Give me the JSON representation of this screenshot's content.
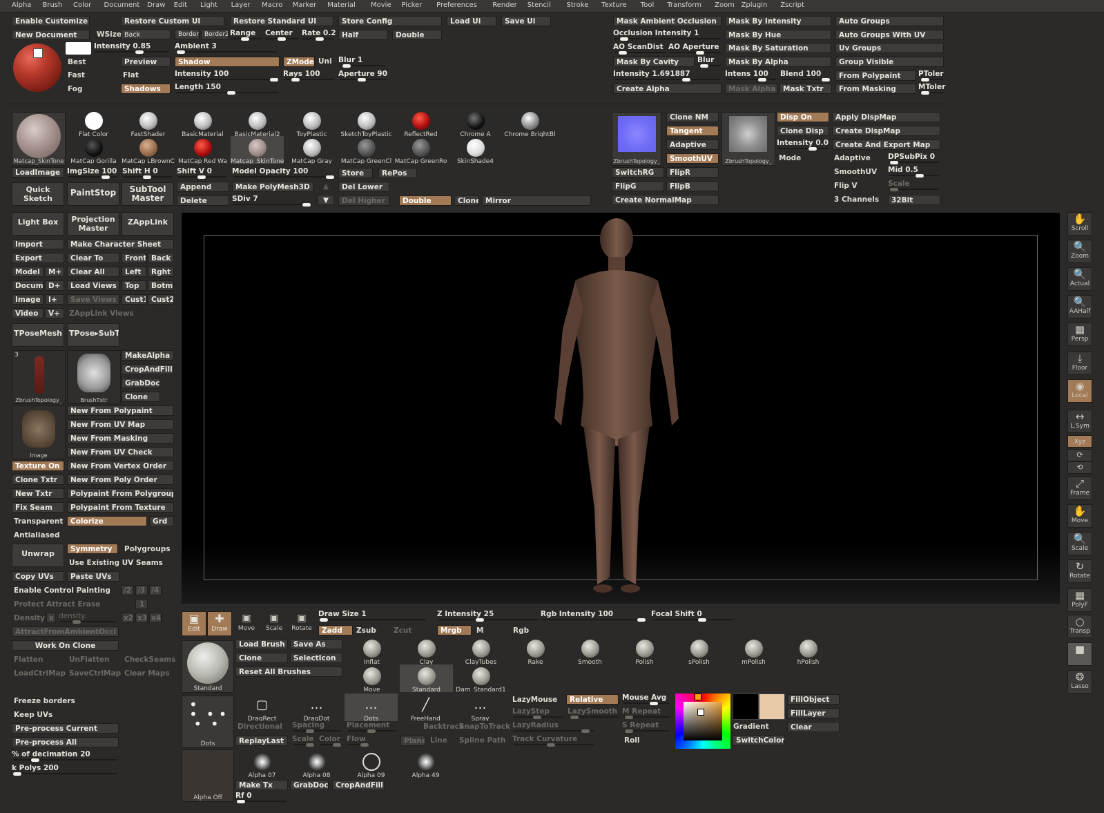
{
  "menu": [
    "Alpha",
    "Brush",
    "Color",
    "Document",
    "Draw",
    "Edit",
    "Light",
    "Layer",
    "Macro",
    "Marker",
    "Material",
    "Movie",
    "Picker",
    "Preferences",
    "Render",
    "Stencil",
    "Stroke",
    "Texture",
    "Tool",
    "Transform",
    "Zoom",
    "Zplugin",
    "Zscript"
  ],
  "colors": {
    "accent": "#a27a56",
    "panel": "#2b2a28",
    "button": "#3d3c3a",
    "canvas": "#000000",
    "secondary_color": "#e8c9a8"
  },
  "top": {
    "enable_customize": "Enable Customize",
    "restore_custom_ui": "Restore Custom UI",
    "restore_standard_ui": "Restore Standard UI",
    "store_config": "Store Config",
    "load_ui": "Load Ui",
    "save_ui": "Save Ui",
    "new_document": "New Document",
    "wsize": "WSize",
    "back": "Back",
    "border": "Border",
    "border2": "Border2",
    "range": "Range",
    "center": "Center",
    "rate": "Rate 0.2",
    "half": "Half",
    "double": "Double",
    "intensity": "Intensity 0.85",
    "ambient": "Ambient 3",
    "best": "Best",
    "preview": "Preview",
    "shadow": "Shadow",
    "zmode": "ZMode",
    "uni": "Uni",
    "blur": "Blur 1",
    "fast": "Fast",
    "flat": "Flat",
    "intensity100": "Intensity 100",
    "rays": "Rays 100",
    "aperture": "Aperture 90",
    "fog": "Fog",
    "shadows": "Shadows",
    "length": "Length 150"
  },
  "mask": {
    "col1": [
      "Mask Ambient Occlusion",
      "Occlusion Intensity 1",
      "AO ScanDist",
      "AO Aperture",
      "Mask By Cavity",
      "Blur",
      "Intensity 1.691887",
      "Create Alpha"
    ],
    "col2": [
      "Mask By Intensity",
      "Mask By Hue",
      "Mask By Saturation",
      "Mask By Alpha",
      "Intens 100",
      "Blend 100",
      "Mask Alpha",
      "Mask Txtr"
    ],
    "col3": [
      "Auto Groups",
      "Auto Groups With UV",
      "Uv Groups",
      "Group Visible",
      "From Polypaint",
      "PToler",
      "From Masking",
      "MToler"
    ]
  },
  "materials": {
    "current": "Matcap_SkinTone",
    "load_image": "LoadImage",
    "row1": [
      "Flat Color",
      "FastShader",
      "BasicMaterial",
      "BasicMaterial2",
      "ToyPlastic",
      "SketchToyPlastic",
      "ReflectRed",
      "Chrome A",
      "Chrome BrightBl"
    ],
    "row2": [
      "MatCap Gorilla",
      "MatCap LBrownC",
      "MatCap Red Wa",
      "Matcap_SkinTone",
      "MatCap Gray",
      "MatCap GreenCl",
      "MatCap GreenRo",
      "SkinShade4"
    ],
    "imgsize": "ImgSize 100",
    "shift_h": "Shift H 0",
    "shift_v": "Shift V 0",
    "model_opacity": "Model Opacity 100",
    "store": "Store",
    "repos": "RePos"
  },
  "subtool": {
    "quick_sketch": "Quick Sketch",
    "paintstop": "PaintStop",
    "subtool_master": "SubTool Master",
    "append": "Append",
    "make_polymesh": "Make PolyMesh3D",
    "del_lower": "Del Lower",
    "delete": "Delete",
    "sdiv": "SDiv 7",
    "del_higher": "Del Higher",
    "double": "Double",
    "clone": "Clone",
    "mirror": "Mirror"
  },
  "normal": {
    "clone_nm": "Clone NM",
    "tangent": "Tangent",
    "adaptive": "Adaptive",
    "smoothuv": "SmoothUV",
    "disp_on": "Disp On",
    "clone_disp": "Clone Disp",
    "intensity": "Intensity 0.0",
    "mode": "Mode",
    "apply_dispmap": "Apply DispMap",
    "create_dispmap": "Create DispMap",
    "create_export": "Create And Export Map",
    "adaptive2": "Adaptive",
    "dpsubpix": "DPSubPix 0",
    "smoothuv2": "SmoothUV",
    "mid": "Mid 0.5",
    "flip_v": "Flip V",
    "scale": "Scale",
    "three_channels": "3 Channels",
    "bit32": "32Bit",
    "switchrg": "SwitchRG",
    "flipr": "FlipR",
    "flipg": "FlipG",
    "flipb": "FlipB",
    "create_normalmap": "Create NormalMap",
    "tex1_label": "ZbrushTopology_",
    "tex2_label": "ZbrushTopology_"
  },
  "left": {
    "light_box": "Light Box",
    "projection_master": "Projection Master",
    "zapplink": "ZAppLink",
    "import": "Import",
    "make_character_sheet": "Make Character Sheet",
    "export": "Export",
    "clear_to": "Clear To",
    "front": "Front",
    "back": "Back",
    "model": "Model",
    "mplus": "M+",
    "clear_all": "Clear All",
    "left": "Left",
    "right": "Rght",
    "docum": "Docum",
    "dplus": "D+",
    "load_views": "Load Views",
    "top": "Top",
    "botm": "Botm",
    "image": "Image",
    "iplus": "I+",
    "save_views": "Save Views",
    "cust1": "Cust1",
    "cust2": "Cust2",
    "video": "Video",
    "vplus": "V+",
    "zapplink_views": "ZAppLink Views",
    "tposemesh": "TPoseMesh",
    "tpose_subt": "TPose▸SubT",
    "thumb_count": "3",
    "thumb1": "ZbrushTopology_",
    "thumb2": "BrushTxtr",
    "thumb3": "Image",
    "makealpha": "MakeAlpha",
    "cropandfill": "CropAndFill",
    "grabdoc": "GrabDoc",
    "clone": "Clone",
    "new_from_polypaint": "New From Polypaint",
    "new_from_uv_map": "New From UV Map",
    "new_from_masking": "New From Masking",
    "new_from_uv_check": "New From UV Check",
    "texture_on": "Texture On",
    "new_from_vertex_order": "New From Vertex Order",
    "clone_txtr": "Clone Txtr",
    "new_from_poly_order": "New From Poly Order",
    "new_txtr": "New Txtr",
    "polypaint_from_polygroups": "Polypaint From Polygroups",
    "fix_seam": "Fix Seam",
    "polypaint_from_texture": "Polypaint From Texture",
    "transparent": "Transparent",
    "colorize": "Colorize",
    "grd": "Grd",
    "antialiased": "Antialiased",
    "unwrap": "Unwrap",
    "symmetry": "Symmetry",
    "polygroups": "Polygroups",
    "use_existing_uv": "Use Existing UV Seams",
    "copy_uvs": "Copy UVs",
    "paste_uvs": "Paste UVs",
    "enable_control_painting": "Enable Control Painting",
    "protect_attract_erase": "Protect Attract Erase",
    "density": "Density",
    "density_slider": "density.",
    "attract_from_ao": "AttractFromAmbientOccl",
    "work_on_clone": "Work On Clone",
    "flatten": "Flatten",
    "unflatten": "UnFlatten",
    "checkseams": "CheckSeams",
    "loadctrlmap": "LoadCtrlMap",
    "savectrlmap": "SaveCtrlMap",
    "clear_maps": "Clear Maps",
    "freeze_borders": "Freeze borders",
    "keep_uvs": "Keep UVs",
    "preprocess_current": "Pre-process Current",
    "preprocess_all": "Pre-process All",
    "pct_decimation": "% of decimation 20",
    "k_polys": "k Polys 200",
    "x2": "x2",
    "x3": "x3",
    "x4": "x4",
    "n2": "/2",
    "n3": "/3",
    "n4": "/4",
    "one": "1",
    "x": "x"
  },
  "right_tools": [
    "Scroll",
    "Zoom",
    "Actual",
    "AAHalf",
    "Persp",
    "Floor",
    "Local",
    "L.Sym",
    "Xyz",
    "",
    "",
    "Frame",
    "Move",
    "Scale",
    "Rotate",
    "PolyF",
    "Transp",
    "Ghost",
    "Lasso"
  ],
  "bottom": {
    "edit": "Edit",
    "draw": "Draw",
    "move": "Move",
    "scale": "Scale",
    "rotate": "Rotate",
    "draw_size": "Draw Size 1",
    "z_intensity": "Z Intensity 25",
    "rgb_intensity": "Rgb Intensity 100",
    "focal_shift": "Focal Shift 0",
    "zadd": "Zadd",
    "zsub": "Zsub",
    "zcut": "Zcut",
    "mrgb": "Mrgb",
    "m": "M",
    "rgb": "Rgb",
    "load_brush": "Load Brush",
    "save_as": "Save As",
    "clone": "Clone",
    "selecticon": "SelectIcon",
    "reset_all_brushes": "Reset All Brushes",
    "current_brush": "Standard",
    "brushes": [
      "Inflat",
      "Clay",
      "ClayTubes",
      "Rake",
      "Smooth",
      "Polish",
      "sPolish",
      "mPolish",
      "hPolish"
    ],
    "brushes2": [
      "Move",
      "Standard",
      "Dam_Standard1"
    ],
    "stroke_current": "Dots",
    "strokes": [
      "DragRect",
      "DragDot",
      "Dots",
      "FreeHand",
      "Spray"
    ],
    "directional": "Directional",
    "spacing": "Spacing",
    "placement": "Placement",
    "backtrack": "Backtrack",
    "snaptotrack": "SnapToTrack",
    "replaylast": "ReplayLast",
    "scale_s": "Scale",
    "color_s": "Color",
    "flow": "Flow",
    "plane": "Plane",
    "line": "Line",
    "spline_path": "Spline Path",
    "lazymouse": "LazyMouse",
    "relative": "Relative",
    "lazystep": "LazyStep",
    "lazysmooth": "LazySmooth",
    "lazyradius": "LazyRadius",
    "track_curvature": "Track Curvature",
    "mouse_avg": "Mouse Avg",
    "m_repeat": "M Repeat",
    "s_repeat": "S Repeat",
    "roll": "Roll",
    "gradient": "Gradient",
    "switchcolor": "SwitchColor",
    "fillobject": "FillObject",
    "filllayer": "FillLayer",
    "clear": "Clear",
    "alpha_current": "Alpha Off",
    "alphas": [
      "Alpha 07",
      "Alpha 08",
      "Alpha 09",
      "Alpha 49"
    ],
    "make_tx": "Make Tx",
    "grabdoc": "GrabDoc",
    "cropandfill": "CropAndFill",
    "rf": "Rf 0"
  }
}
